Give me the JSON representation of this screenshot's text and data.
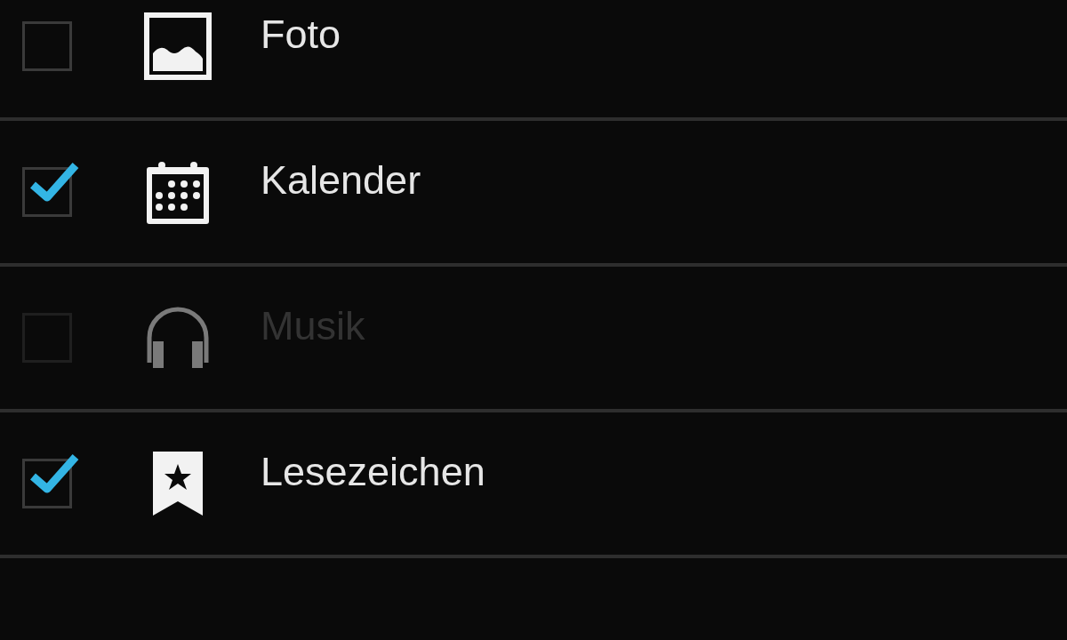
{
  "items": [
    {
      "label": "Foto",
      "checked": false,
      "disabled": false
    },
    {
      "label": "Kalender",
      "checked": true,
      "disabled": false
    },
    {
      "label": "Musik",
      "checked": false,
      "disabled": true
    },
    {
      "label": "Lesezeichen",
      "checked": true,
      "disabled": false
    }
  ]
}
